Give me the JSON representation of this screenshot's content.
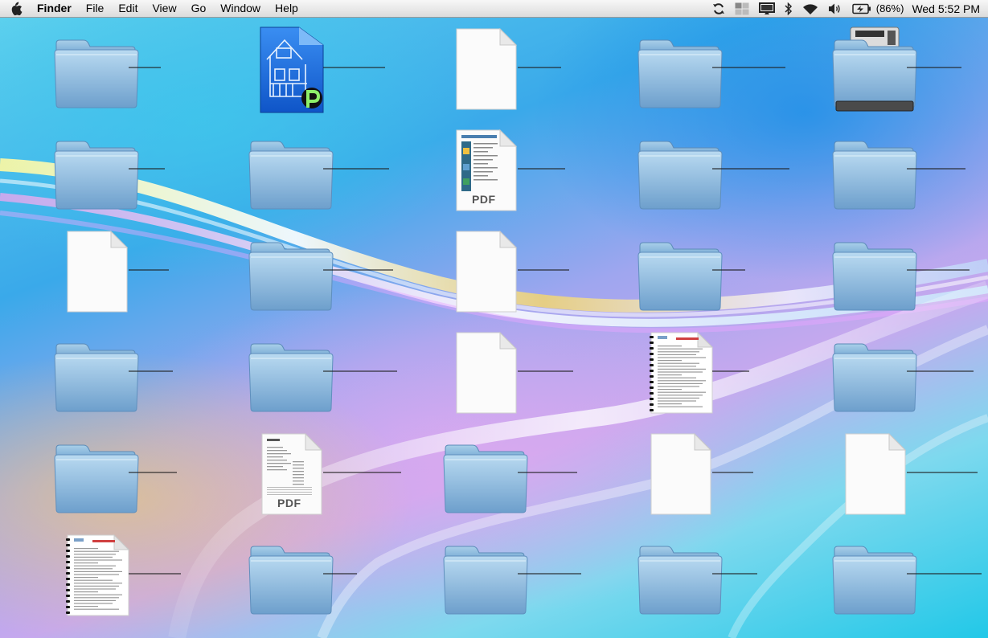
{
  "menubar": {
    "app_name": "Finder",
    "menus": [
      "File",
      "Edit",
      "View",
      "Go",
      "Window",
      "Help"
    ],
    "status_icons": [
      "sync-icon",
      "spaces-icon",
      "display-icon",
      "bluetooth-icon",
      "wifi-icon",
      "volume-icon",
      "battery-icon"
    ],
    "battery_percent": "(86%)",
    "clock": "Wed 5:52 PM"
  },
  "desktop": {
    "items": [
      {
        "kind": "folder"
      },
      {
        "kind": "app-doc"
      },
      {
        "kind": "document"
      },
      {
        "kind": "folder"
      },
      {
        "kind": "drive"
      },
      {
        "kind": "folder"
      },
      {
        "kind": "folder"
      },
      {
        "kind": "pdf"
      },
      {
        "kind": "folder"
      },
      {
        "kind": "folder"
      },
      {
        "kind": "document"
      },
      {
        "kind": "folder"
      },
      {
        "kind": "document"
      },
      {
        "kind": "folder"
      },
      {
        "kind": "folder"
      },
      {
        "kind": "folder"
      },
      {
        "kind": "folder"
      },
      {
        "kind": "document"
      },
      {
        "kind": "doc-preview"
      },
      {
        "kind": "folder"
      },
      {
        "kind": "folder"
      },
      {
        "kind": "pdf"
      },
      {
        "kind": "folder"
      },
      {
        "kind": "document"
      },
      {
        "kind": "document"
      },
      {
        "kind": "doc-preview"
      },
      {
        "kind": "folder"
      },
      {
        "kind": "folder"
      },
      {
        "kind": "folder"
      },
      {
        "kind": "folder"
      }
    ],
    "pdf_label": "PDF"
  }
}
